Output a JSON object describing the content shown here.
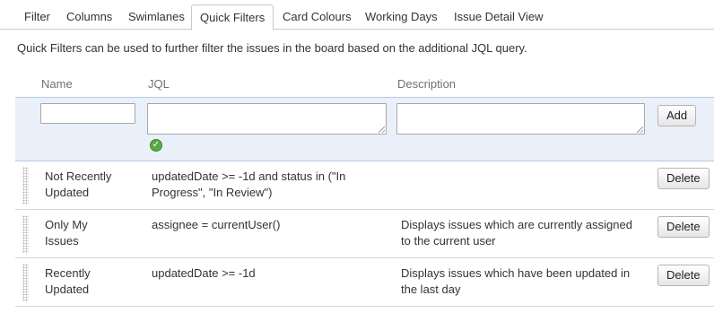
{
  "tabs": [
    {
      "label": "Filter",
      "active": false
    },
    {
      "label": "Columns",
      "active": false
    },
    {
      "label": "Swimlanes",
      "active": false
    },
    {
      "label": "Quick Filters",
      "active": true
    },
    {
      "label": "Card Colours",
      "active": false
    },
    {
      "label": "Working Days",
      "active": false
    },
    {
      "label": "Issue Detail View",
      "active": false
    }
  ],
  "intro": "Quick Filters can be used to further filter the issues in the board based on the additional JQL query.",
  "columns": {
    "name": "Name",
    "jql": "JQL",
    "description": "Description"
  },
  "add_form": {
    "name_value": "",
    "jql_value": "",
    "description_value": "",
    "valid_icon": "check-circle-icon",
    "add_label": "Add"
  },
  "filters": [
    {
      "name": "Not Recently Updated",
      "jql": "updatedDate >= -1d and status in (\"In Progress\", \"In Review\")",
      "description": "",
      "delete_label": "Delete"
    },
    {
      "name": "Only My Issues",
      "jql": "assignee = currentUser()",
      "description": "Displays issues which are currently assigned to the current user",
      "delete_label": "Delete"
    },
    {
      "name": "Recently Updated",
      "jql": "updatedDate >= -1d",
      "description": "Displays issues which have been updated in the last day",
      "delete_label": "Delete"
    }
  ],
  "colors": {
    "add_row_bg": "#e9f0f9",
    "valid_green": "#5aa845",
    "border": "#c8c8c8"
  }
}
